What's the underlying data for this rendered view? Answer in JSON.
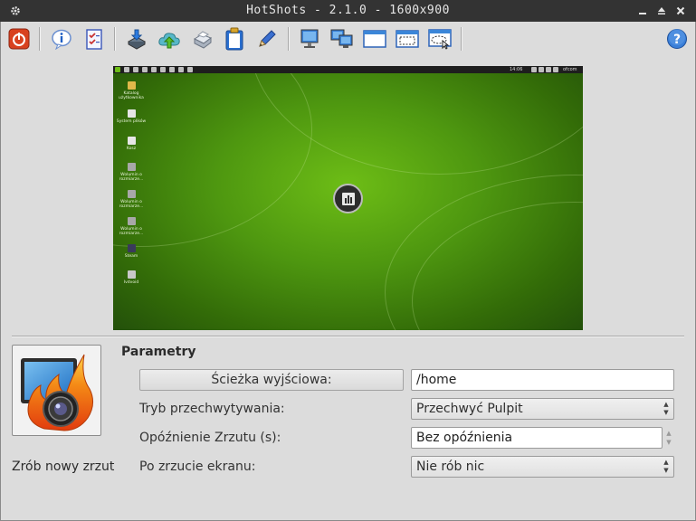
{
  "window": {
    "title": "HotShots - 2.1.0 - 1600x900",
    "accent": "#333333"
  },
  "toolbar": {
    "items": [
      "quit-icon",
      "about-icon",
      "tasks-icon",
      "save-icon",
      "upload-icon",
      "print-icon",
      "clipboard-icon",
      "edit-icon",
      "screen-icon",
      "multiscreen-icon",
      "window-icon",
      "region-icon",
      "freehand-icon",
      "help-icon"
    ]
  },
  "preview": {
    "desktop_icons": [
      "Katalog użytkownika",
      "System plików",
      "Kosz",
      "Wolumin o rozmiarze...",
      "Wolumin o rozmiarze...",
      "Wolumin o rozmiarze...",
      "Steam",
      "Ivdvoid"
    ],
    "clock": "14:06",
    "user": "ofcom"
  },
  "actions": {
    "new_shot_label": "Zrób nowy zrzut"
  },
  "params": {
    "title": "Parametry",
    "output_path_button": "Ścieżka wyjściowa:",
    "output_path_value": "/home",
    "capture_mode_label": "Tryb przechwytywania:",
    "capture_mode_value": "Przechwyć Pulpit",
    "delay_label": "Opóźnienie Zrzutu (s):",
    "delay_value": "Bez opóźnienia",
    "after_capture_label": "Po zrzucie ekranu:",
    "after_capture_value": "Nie rób nic"
  }
}
